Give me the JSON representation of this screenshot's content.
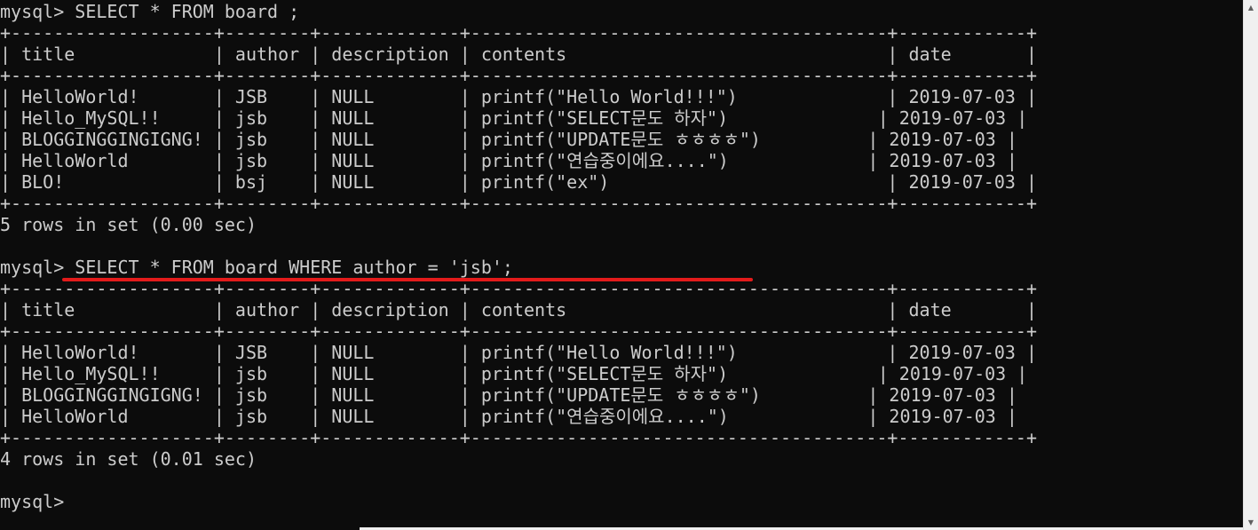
{
  "terminal": {
    "lines": [
      "mysql> SELECT * FROM board ;",
      "+-------------------+--------+-------------+---------------------------------------+------------+",
      "| title             | author | description | contents                              | date       |",
      "+-------------------+--------+-------------+---------------------------------------+------------+",
      "| HelloWorld!       | JSB    | NULL        | printf(\"Hello World!!!\")              | 2019-07-03 |",
      "| Hello_MySQL!!     | jsb    | NULL        | printf(\"SELECT문도 하자\")              | 2019-07-03 |",
      "| BLOGGINGGINGIGNG! | jsb    | NULL        | printf(\"UPDATE문도 ㅎㅎㅎㅎ\")          | 2019-07-03 |",
      "| HelloWorld        | jsb    | NULL        | printf(\"연습중이에요....\")             | 2019-07-03 |",
      "| BLO!              | bsj    | NULL        | printf(\"ex\")                          | 2019-07-03 |",
      "+-------------------+--------+-------------+---------------------------------------+------------+",
      "5 rows in set (0.00 sec)",
      "",
      "mysql> SELECT * FROM board WHERE author = 'jsb';",
      "+-------------------+--------+-------------+---------------------------------------+------------+",
      "| title             | author | description | contents                              | date       |",
      "+-------------------+--------+-------------+---------------------------------------+------------+",
      "| HelloWorld!       | JSB    | NULL        | printf(\"Hello World!!!\")              | 2019-07-03 |",
      "| Hello_MySQL!!     | jsb    | NULL        | printf(\"SELECT문도 하자\")              | 2019-07-03 |",
      "| BLOGGINGGINGIGNG! | jsb    | NULL        | printf(\"UPDATE문도 ㅎㅎㅎㅎ\")          | 2019-07-03 |",
      "| HelloWorld        | jsb    | NULL        | printf(\"연습중이에요....\")             | 2019-07-03 |",
      "+-------------------+--------+-------------+---------------------------------------+------------+",
      "4 rows in set (0.01 sec)",
      "",
      "mysql>"
    ]
  },
  "colors": {
    "background": "#0c0c0c",
    "text": "#cccccc",
    "annotation": "#e31b1b"
  },
  "icons": {
    "scroll_up": "scroll-up-arrow-icon",
    "scroll_down": "scroll-down-arrow-icon"
  }
}
